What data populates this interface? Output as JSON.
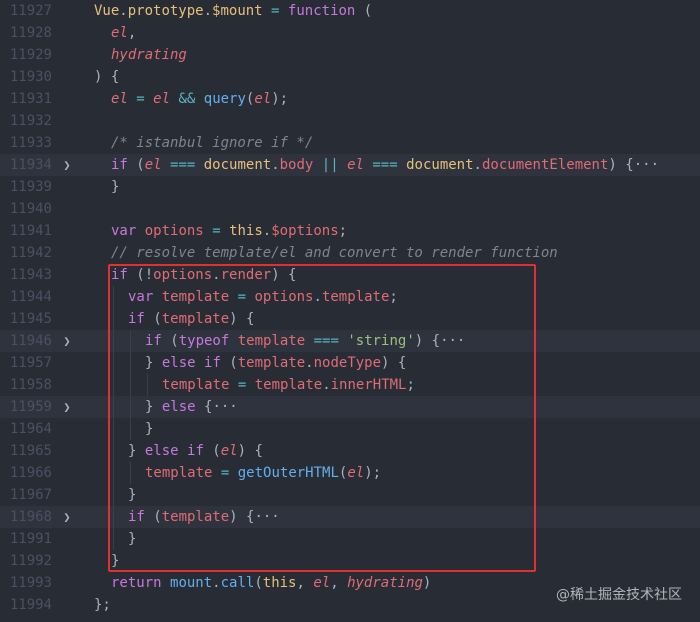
{
  "editor": {
    "lines": [
      {
        "n": "11927",
        "fold": false,
        "indent": 0,
        "tokens": [
          [
            "y",
            "Vue"
          ],
          [
            "e",
            "."
          ],
          [
            "y",
            "prototype"
          ],
          [
            "e",
            "."
          ],
          [
            "y",
            "$mount"
          ],
          [
            "e",
            " "
          ],
          [
            "o",
            "="
          ],
          [
            "e",
            " "
          ],
          [
            "k",
            "function"
          ],
          [
            "e",
            " ("
          ]
        ]
      },
      {
        "n": "11928",
        "fold": false,
        "indent": 1,
        "tokens": [
          [
            "v",
            "el"
          ],
          [
            "e",
            ","
          ]
        ]
      },
      {
        "n": "11929",
        "fold": false,
        "indent": 1,
        "tokens": [
          [
            "v",
            "hydrating"
          ]
        ]
      },
      {
        "n": "11930",
        "fold": false,
        "indent": 0,
        "tokens": [
          [
            "e",
            ") {"
          ]
        ]
      },
      {
        "n": "11931",
        "fold": false,
        "indent": 1,
        "tokens": [
          [
            "v",
            "el"
          ],
          [
            "e",
            " "
          ],
          [
            "o",
            "="
          ],
          [
            "e",
            " "
          ],
          [
            "v",
            "el"
          ],
          [
            "e",
            " "
          ],
          [
            "o",
            "&&"
          ],
          [
            "e",
            " "
          ],
          [
            "f",
            "query"
          ],
          [
            "e",
            "("
          ],
          [
            "v",
            "el"
          ],
          [
            "e",
            ");"
          ]
        ]
      },
      {
        "n": "11932",
        "fold": false,
        "indent": 1,
        "tokens": []
      },
      {
        "n": "11933",
        "fold": false,
        "indent": 1,
        "tokens": [
          [
            "c",
            "/* istanbul ignore if */"
          ]
        ]
      },
      {
        "n": "11934",
        "fold": true,
        "indent": 1,
        "tokens": [
          [
            "k",
            "if"
          ],
          [
            "e",
            " ("
          ],
          [
            "v",
            "el"
          ],
          [
            "e",
            " "
          ],
          [
            "o",
            "==="
          ],
          [
            "e",
            " "
          ],
          [
            "y",
            "document"
          ],
          [
            "e",
            "."
          ],
          [
            "p",
            "body"
          ],
          [
            "e",
            " "
          ],
          [
            "o",
            "||"
          ],
          [
            "e",
            " "
          ],
          [
            "v",
            "el"
          ],
          [
            "e",
            " "
          ],
          [
            "o",
            "==="
          ],
          [
            "e",
            " "
          ],
          [
            "y",
            "document"
          ],
          [
            "e",
            "."
          ],
          [
            "p",
            "documentElement"
          ],
          [
            "e",
            ") {"
          ],
          [
            "ell",
            "···"
          ]
        ]
      },
      {
        "n": "11939",
        "fold": false,
        "indent": 1,
        "tokens": [
          [
            "e",
            "}"
          ]
        ]
      },
      {
        "n": "11940",
        "fold": false,
        "indent": 1,
        "tokens": []
      },
      {
        "n": "11941",
        "fold": false,
        "indent": 1,
        "tokens": [
          [
            "k",
            "var"
          ],
          [
            "e",
            " "
          ],
          [
            "p",
            "options"
          ],
          [
            "e",
            " "
          ],
          [
            "o",
            "="
          ],
          [
            "e",
            " "
          ],
          [
            "y",
            "this"
          ],
          [
            "e",
            "."
          ],
          [
            "p",
            "$options"
          ],
          [
            "e",
            ";"
          ]
        ]
      },
      {
        "n": "11942",
        "fold": false,
        "indent": 1,
        "tokens": [
          [
            "c",
            "// resolve template/el and convert to render function"
          ]
        ]
      },
      {
        "n": "11943",
        "fold": false,
        "indent": 1,
        "tokens": [
          [
            "k",
            "if"
          ],
          [
            "e",
            " (!"
          ],
          [
            "p",
            "options"
          ],
          [
            "e",
            "."
          ],
          [
            "p",
            "render"
          ],
          [
            "e",
            ") {"
          ]
        ]
      },
      {
        "n": "11944",
        "fold": false,
        "indent": 2,
        "tokens": [
          [
            "k",
            "var"
          ],
          [
            "e",
            " "
          ],
          [
            "p",
            "template"
          ],
          [
            "e",
            " "
          ],
          [
            "o",
            "="
          ],
          [
            "e",
            " "
          ],
          [
            "p",
            "options"
          ],
          [
            "e",
            "."
          ],
          [
            "p",
            "template"
          ],
          [
            "e",
            ";"
          ]
        ]
      },
      {
        "n": "11945",
        "fold": false,
        "indent": 2,
        "tokens": [
          [
            "k",
            "if"
          ],
          [
            "e",
            " ("
          ],
          [
            "p",
            "template"
          ],
          [
            "e",
            ") {"
          ]
        ]
      },
      {
        "n": "11946",
        "fold": true,
        "indent": 3,
        "tokens": [
          [
            "k",
            "if"
          ],
          [
            "e",
            " ("
          ],
          [
            "k",
            "typeof"
          ],
          [
            "e",
            " "
          ],
          [
            "p",
            "template"
          ],
          [
            "e",
            " "
          ],
          [
            "o",
            "==="
          ],
          [
            "e",
            " "
          ],
          [
            "s",
            "'string'"
          ],
          [
            "e",
            ") {"
          ],
          [
            "ell",
            "···"
          ]
        ]
      },
      {
        "n": "11957",
        "fold": false,
        "indent": 3,
        "tokens": [
          [
            "e",
            "} "
          ],
          [
            "k",
            "else"
          ],
          [
            "e",
            " "
          ],
          [
            "k",
            "if"
          ],
          [
            "e",
            " ("
          ],
          [
            "p",
            "template"
          ],
          [
            "e",
            "."
          ],
          [
            "p",
            "nodeType"
          ],
          [
            "e",
            ") {"
          ]
        ]
      },
      {
        "n": "11958",
        "fold": false,
        "indent": 4,
        "tokens": [
          [
            "p",
            "template"
          ],
          [
            "e",
            " "
          ],
          [
            "o",
            "="
          ],
          [
            "e",
            " "
          ],
          [
            "p",
            "template"
          ],
          [
            "e",
            "."
          ],
          [
            "p",
            "innerHTML"
          ],
          [
            "e",
            ";"
          ]
        ]
      },
      {
        "n": "11959",
        "fold": true,
        "indent": 3,
        "tokens": [
          [
            "e",
            "} "
          ],
          [
            "k",
            "else"
          ],
          [
            "e",
            " {"
          ],
          [
            "ell",
            "···"
          ]
        ]
      },
      {
        "n": "11964",
        "fold": false,
        "indent": 3,
        "tokens": [
          [
            "e",
            "}"
          ]
        ]
      },
      {
        "n": "11965",
        "fold": false,
        "indent": 2,
        "tokens": [
          [
            "e",
            "} "
          ],
          [
            "k",
            "else"
          ],
          [
            "e",
            " "
          ],
          [
            "k",
            "if"
          ],
          [
            "e",
            " ("
          ],
          [
            "v",
            "el"
          ],
          [
            "e",
            ") {"
          ]
        ]
      },
      {
        "n": "11966",
        "fold": false,
        "indent": 3,
        "tokens": [
          [
            "p",
            "template"
          ],
          [
            "e",
            " "
          ],
          [
            "o",
            "="
          ],
          [
            "e",
            " "
          ],
          [
            "f",
            "getOuterHTML"
          ],
          [
            "e",
            "("
          ],
          [
            "v",
            "el"
          ],
          [
            "e",
            ");"
          ]
        ]
      },
      {
        "n": "11967",
        "fold": false,
        "indent": 2,
        "tokens": [
          [
            "e",
            "}"
          ]
        ]
      },
      {
        "n": "11968",
        "fold": true,
        "indent": 2,
        "tokens": [
          [
            "k",
            "if"
          ],
          [
            "e",
            " ("
          ],
          [
            "p",
            "template"
          ],
          [
            "e",
            ") {"
          ],
          [
            "ell",
            "···"
          ]
        ]
      },
      {
        "n": "11991",
        "fold": false,
        "indent": 2,
        "tokens": [
          [
            "e",
            "}"
          ]
        ]
      },
      {
        "n": "11992",
        "fold": false,
        "indent": 1,
        "tokens": [
          [
            "e",
            "}"
          ]
        ]
      },
      {
        "n": "11993",
        "fold": false,
        "indent": 1,
        "tokens": [
          [
            "k",
            "return"
          ],
          [
            "e",
            " "
          ],
          [
            "f",
            "mount"
          ],
          [
            "e",
            "."
          ],
          [
            "f",
            "call"
          ],
          [
            "e",
            "("
          ],
          [
            "y",
            "this"
          ],
          [
            "e",
            ", "
          ],
          [
            "v",
            "el"
          ],
          [
            "e",
            ", "
          ],
          [
            "v",
            "hydrating"
          ],
          [
            "e",
            ")"
          ]
        ]
      },
      {
        "n": "11994",
        "fold": false,
        "indent": 0,
        "tokens": [
          [
            "e",
            "};"
          ]
        ]
      }
    ],
    "fold_icon": "chevron-right-icon"
  },
  "watermark": "@稀土掘金技术社区",
  "colors": {
    "background": "#282c34",
    "keyword": "#c678dd",
    "function": "#61afef",
    "variable": "#e06c75",
    "type": "#e5c07b",
    "string": "#98c379",
    "comment": "#7f848e",
    "highlight_box": "#e0302f"
  }
}
